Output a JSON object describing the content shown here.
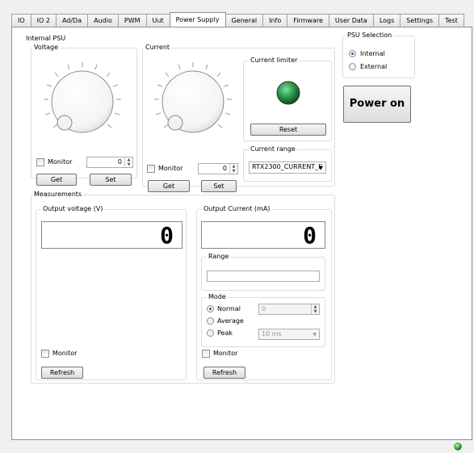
{
  "tabs": [
    "IO",
    "IO 2",
    "Ad/Da",
    "Audio",
    "PWM",
    "Uut",
    "Power Supply",
    "General",
    "Info",
    "Firmware",
    "User Data",
    "Logs",
    "Settings",
    "Test"
  ],
  "internal_psu": {
    "title": "Internal PSU",
    "voltage": {
      "title": "Voltage",
      "monitor_label": "Monitor",
      "value": "0",
      "get_label": "Get",
      "set_label": "Set"
    },
    "current": {
      "title": "Current",
      "monitor_label": "Monitor",
      "value": "0",
      "get_label": "Get",
      "set_label": "Set"
    },
    "current_limiter": {
      "title": "Current limiter",
      "reset_label": "Reset",
      "led_color": "#2f9e4e"
    },
    "current_range": {
      "title": "Current range",
      "selected": "RTX2300_CURRENT_F"
    }
  },
  "psu_selection": {
    "title": "PSU Selection",
    "options": [
      "Internal",
      "External"
    ],
    "selected": "Internal"
  },
  "power_button": {
    "label": "Power on"
  },
  "measurements": {
    "title": "Measurements",
    "voltage": {
      "title": "Output voltage (V)",
      "value": "0",
      "monitor_label": "Monitor",
      "refresh_label": "Refresh"
    },
    "current": {
      "title": "Output Current (mA)",
      "value": "0",
      "monitor_label": "Monitor",
      "refresh_label": "Refresh",
      "range_title": "Range",
      "range_value": "",
      "mode": {
        "title": "Mode",
        "options": [
          "Normal",
          "Average",
          "Peak"
        ],
        "selected": "Normal",
        "count_value": "0",
        "time_value": "10 ms"
      }
    }
  },
  "status": {
    "led_color": "#3cb043"
  }
}
